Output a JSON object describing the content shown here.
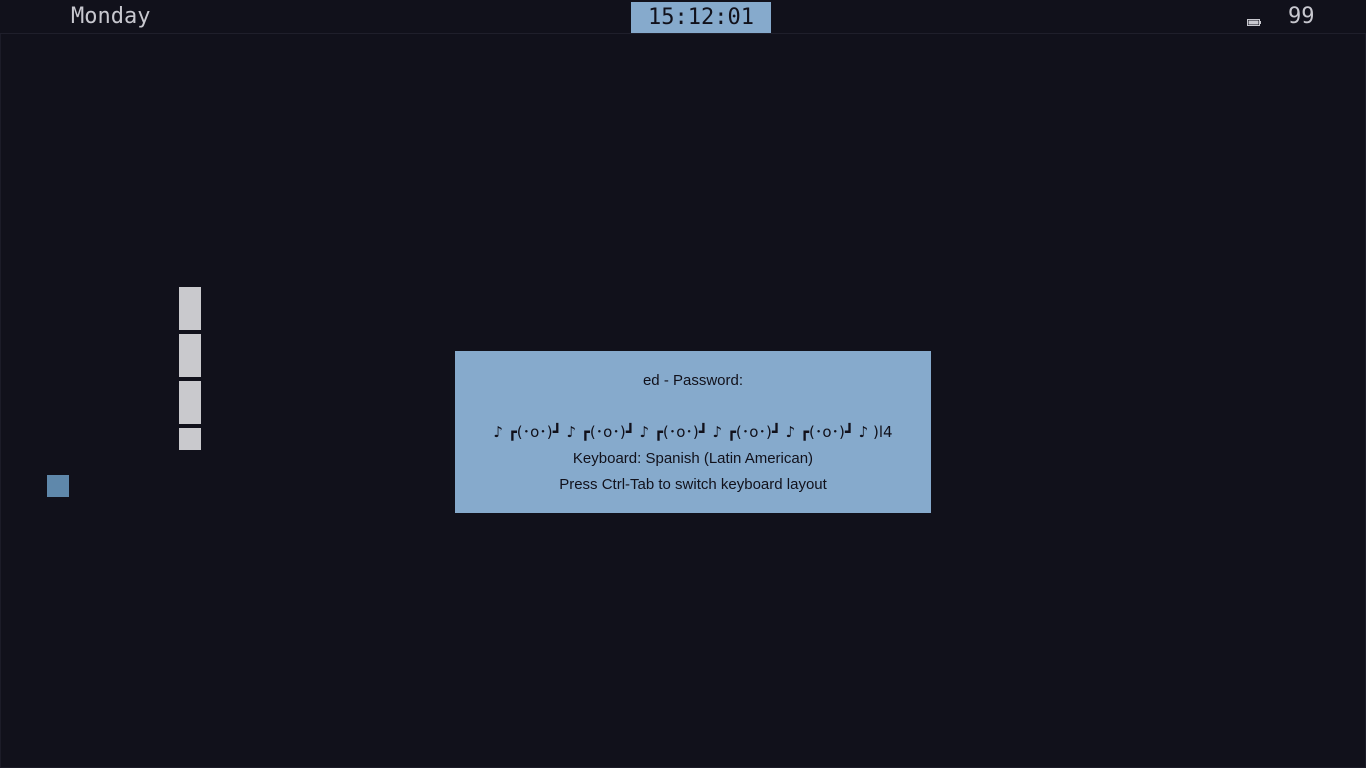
{
  "topbar": {
    "day": "Monday",
    "clock": "15:12:01",
    "battery_icon": "battery-icon",
    "battery_level": "99"
  },
  "colors": {
    "background": "#11111b",
    "accent": "#86aacc",
    "bar": "#c9c9cd",
    "square": "#5f88ab"
  },
  "lock_dialog": {
    "prompt": "ed - Password:",
    "password_display": "♪ ┏(･o･)┛ ♪ ┏(･o･)┛ ♪ ┏(･o･)┛ ♪ ┏(･o･)┛ ♪ ┏(･o･)┛ ♪ )l4",
    "keyboard_layout": "Keyboard: Spanish (Latin American)",
    "switch_hint": "Press Ctrl-Tab to switch keyboard layout"
  }
}
